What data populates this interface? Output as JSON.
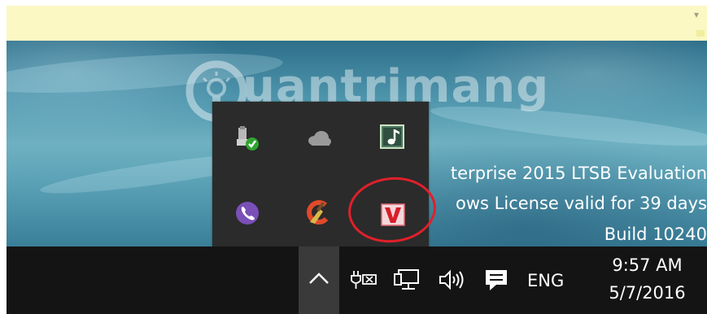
{
  "watermark": {
    "text": "uantrimang"
  },
  "license_notice": {
    "line1": "terprise 2015 LTSB Evaluation",
    "line2": "ows License valid for 39 days",
    "line3": "Build 10240"
  },
  "tray_flyout": {
    "icons": [
      "safely-remove-hardware-icon",
      "onedrive-icon",
      "music-player-icon",
      "viber-icon",
      "ccleaner-icon",
      "vietkey-icon"
    ],
    "highlighted_icon": "vietkey-icon"
  },
  "taskbar": {
    "show_hidden_icons": "chevron-up-icon",
    "system_icons": [
      "power-battery-icon",
      "network-icon",
      "volume-icon",
      "action-center-icon"
    ],
    "language": "ENG",
    "time": "9:57 AM",
    "date": "5/7/2016"
  },
  "colors": {
    "notification_bar": "#fcf8c4",
    "flyout": "#2b2b2b",
    "taskbar": "#141414",
    "highlight_ring": "#e0202a"
  }
}
